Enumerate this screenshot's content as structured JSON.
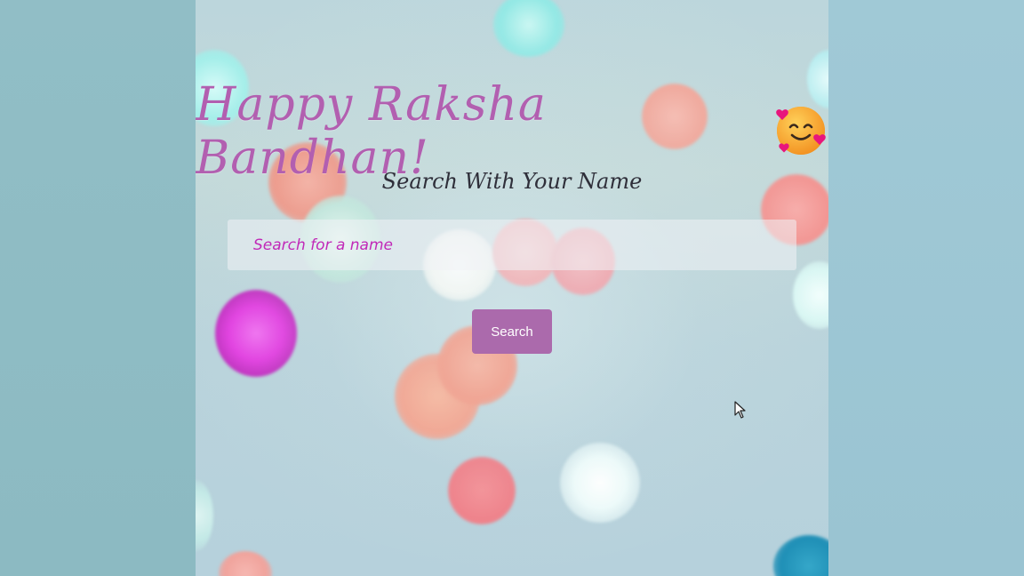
{
  "page": {
    "title": "Happy Raksha Bandhan!",
    "emoji": "smiling-face-with-hearts",
    "subtitle": "Search With Your Name"
  },
  "search": {
    "placeholder": "Search for a name",
    "value": "",
    "button_label": "Search"
  },
  "colors": {
    "title": "#b25fb0",
    "placeholder": "#c129b8",
    "button": "#ab6aac",
    "subtitle": "#2f2f3a"
  }
}
